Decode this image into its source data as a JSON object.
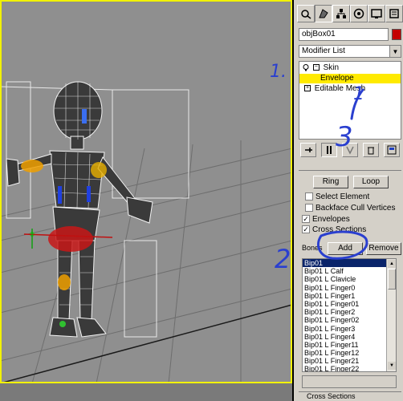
{
  "command_panel": {
    "tabs": [
      "create-icon",
      "modify-icon",
      "hierarchy-icon",
      "motion-icon",
      "display-icon",
      "utilities-icon"
    ],
    "object_name": "objBox01",
    "object_color": "#c40000",
    "modifier_list": "Modifier List",
    "stack": [
      {
        "label": "Skin",
        "expanded": true
      },
      {
        "label": "Envelope",
        "selected": true
      },
      {
        "label": "Editable Mesh"
      }
    ],
    "stack_buttons": [
      "pin-stack-icon",
      "show-end-result-icon",
      "make-unique-icon",
      "remove-modifier-icon",
      "configure-modifier-sets-icon"
    ]
  },
  "parameters": {
    "ring_label": "Ring",
    "loop_label": "Loop",
    "select_element_label": "Select Element",
    "select_element_checked": false,
    "backface_label": "Backface Cull Vertices",
    "backface_checked": false,
    "envelopes_label": "Envelopes",
    "envelopes_checked": true,
    "cross_sections_label": "Cross Sections",
    "cross_sections_checked": true,
    "bones_label": "Bones",
    "add_label": "Add",
    "remove_label": "Remove",
    "bones": [
      "Bip01",
      "Bip01 L Calf",
      "Bip01 L Clavicle",
      "Bip01 L Finger0",
      "Bip01 L Finger1",
      "Bip01 L Finger01",
      "Bip01 L Finger2",
      "Bip01 L Finger02",
      "Bip01 L Finger3",
      "Bip01 L Finger4",
      "Bip01 L Finger11",
      "Bip01 L Finger12",
      "Bip01 L Finger21",
      "Bip01 L Finger22"
    ],
    "selected_bone": "Bip01",
    "cross_sections_group": "Cross Sections"
  },
  "annotations": [
    "1.",
    "1",
    "3",
    "2"
  ],
  "colors": {
    "viewport_bg": "#8f8f8f",
    "active_frame": "#f2f200",
    "stack_highlight": "#ffea00",
    "list_selection": "#0a246a",
    "annotation_ink": "#2a3fcf"
  }
}
